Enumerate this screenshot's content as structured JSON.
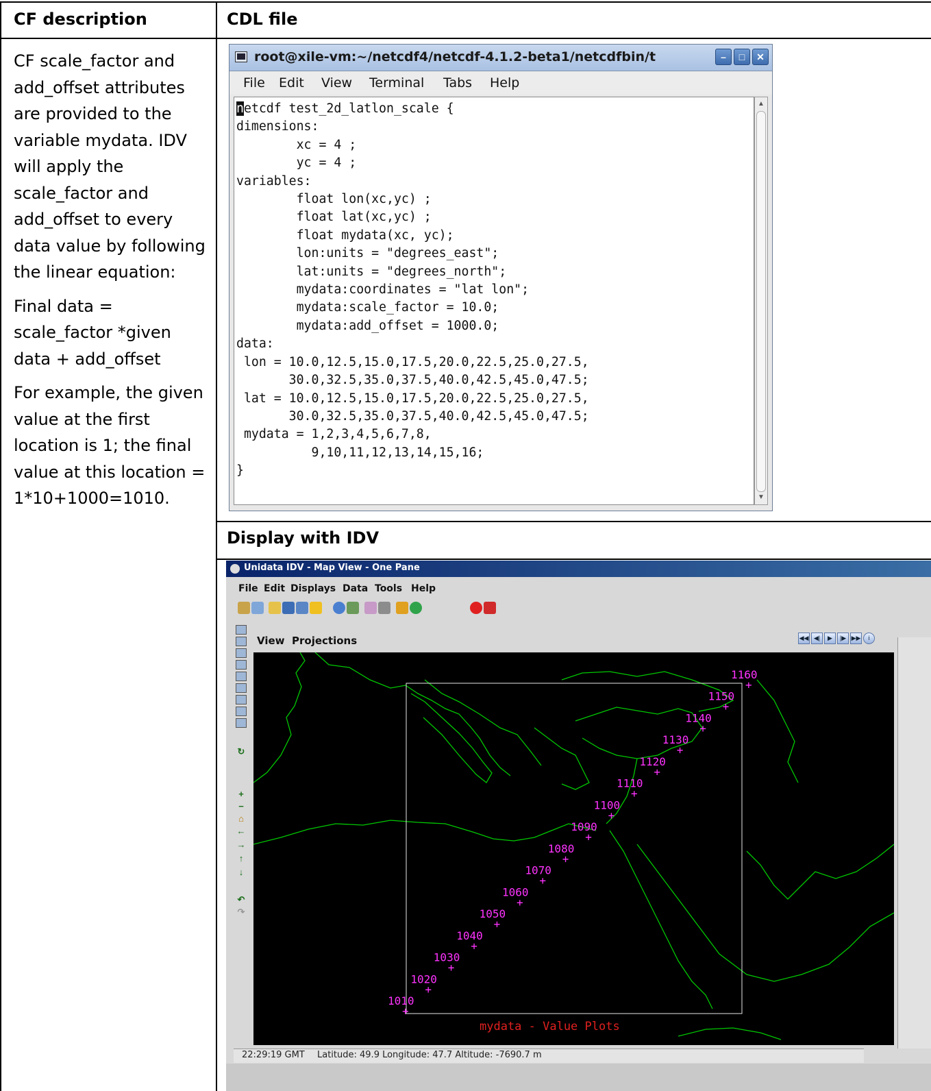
{
  "table": {
    "col1_header": "CF description",
    "col2_header": "CDL file",
    "display_header": "Display with IDV"
  },
  "description": {
    "para1": "CF scale_factor and add_offset attributes are provided to the variable mydata. IDV will apply the scale_factor and add_offset to every data value by following the linear equation:",
    "para2": "Final data = scale_factor *given data + add_offset",
    "para3": "For example, the given value at the first location is 1; the final value at this location = 1*10+1000=1010."
  },
  "terminal": {
    "title": "root@xile-vm:~/netcdf4/netcdf-4.1.2-beta1/netcdfbin/t",
    "menu": [
      "File",
      "Edit",
      "View",
      "Terminal",
      "Tabs",
      "Help"
    ],
    "first_char": "n",
    "content": "etcdf test_2d_latlon_scale {\ndimensions:\n        xc = 4 ;\n        yc = 4 ;\nvariables:\n        float lon(xc,yc) ;\n        float lat(xc,yc) ;\n        float mydata(xc, yc);\n        lon:units = \"degrees_east\";\n        lat:units = \"degrees_north\";\n        mydata:coordinates = \"lat lon\";\n        mydata:scale_factor = 10.0;\n        mydata:add_offset = 1000.0;\ndata:\n lon = 10.0,12.5,15.0,17.5,20.0,22.5,25.0,27.5,\n       30.0,32.5,35.0,37.5,40.0,42.5,45.0,47.5;\n lat = 10.0,12.5,15.0,17.5,20.0,22.5,25.0,27.5,\n       30.0,32.5,35.0,37.5,40.0,42.5,45.0,47.5;\n mydata = 1,2,3,4,5,6,7,8,\n          9,10,11,12,13,14,15,16;\n}"
  },
  "idv": {
    "title": "Unidata IDV - Map View - One Pane",
    "menu": [
      "File",
      "Edit",
      "Displays",
      "Data",
      "Tools",
      "Help"
    ],
    "view_menu": [
      "View",
      "Projections"
    ],
    "map_label": "mydata - Value Plots",
    "point_values": [
      "1010",
      "1020",
      "1030",
      "1040",
      "1050",
      "1060",
      "1070",
      "1080",
      "1090",
      "1100",
      "1110",
      "1120",
      "1130",
      "1140",
      "1150",
      "1160"
    ],
    "status": {
      "time": "22:29:19 GMT",
      "location": "Latitude: 49.9  Longitude: 47.7  Altitude: -7690.7 m"
    },
    "colors": {
      "coastline": "#00c800",
      "points": "#ff33ff",
      "label": "#e02020"
    }
  }
}
